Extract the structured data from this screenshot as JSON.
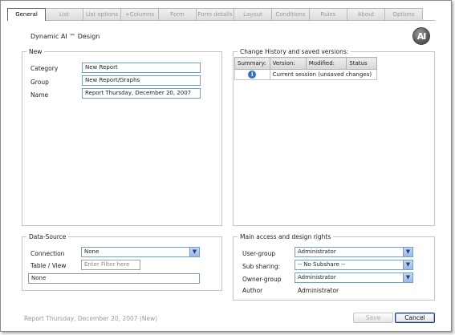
{
  "tabs": [
    "General",
    "List",
    "List options",
    "+Columns",
    "Form",
    "Form details",
    "Layout",
    "Conditions",
    "Rules",
    "About",
    "Options"
  ],
  "page_title": "Dynamic AI ™ Design",
  "logo_text": "AI",
  "new_group": {
    "legend": "New",
    "category_label": "Category",
    "category_value": "New Report",
    "group_label": "Group",
    "group_value": "New Report/Graphs",
    "name_label": "Name",
    "name_value": "Report Thursday, December 20, 2007"
  },
  "history": {
    "legend": "Change History and saved versions:",
    "columns": [
      "Summary:",
      "Version:",
      "Modified:",
      "Status"
    ],
    "rows": [
      {
        "icon": "info-icon",
        "text": "Current session (unsaved changes)"
      }
    ]
  },
  "datasource": {
    "legend": "Data-Source",
    "connection_label": "Connection",
    "connection_value": "None",
    "table_label": "Table / View",
    "filter_placeholder": "Enter Filter here",
    "table_value": "None"
  },
  "access": {
    "legend": "Main access and design rights",
    "user_group_label": "User-group",
    "user_group_value": "Administrator",
    "sub_sharing_label": "Sub sharing:",
    "sub_sharing_value": "-- No Subshare --",
    "owner_group_label": "Owner-group",
    "owner_group_value": "Administrator",
    "author_label": "Author",
    "author_value": "Administrator"
  },
  "footer": {
    "status": "Report Thursday, December 20, 2007 (New)",
    "save_label": "Save",
    "cancel_label": "Cancel"
  }
}
